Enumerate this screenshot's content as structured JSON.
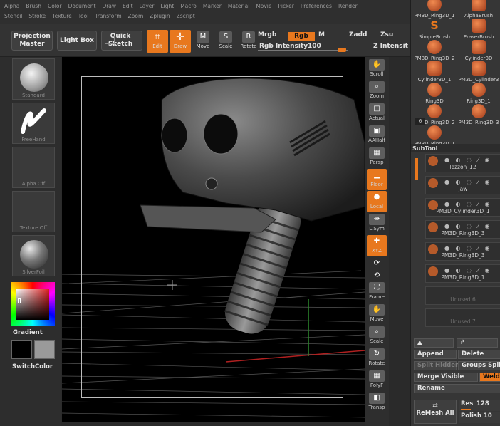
{
  "menus": {
    "row1": [
      "Alpha",
      "Brush",
      "Color",
      "Document",
      "Draw",
      "Edit",
      "Layer",
      "Light",
      "Macro",
      "Marker",
      "Material",
      "Movie",
      "Picker",
      "Preferences",
      "Render"
    ],
    "row2": [
      "Stencil",
      "Stroke",
      "Texture",
      "Tool",
      "Transform",
      "Zoom",
      "Zplugin",
      "Zscript"
    ]
  },
  "toolbar": {
    "projection_master": "Projection Master",
    "light_box": "Light Box",
    "quick_sketch": "Quick Sketch",
    "tools": [
      {
        "label": "Edit",
        "icon": "edit-icon",
        "active": true
      },
      {
        "label": "Draw",
        "icon": "draw-icon",
        "active": true
      },
      {
        "label": "Move",
        "icon": "move-icon",
        "active": false
      },
      {
        "label": "Scale",
        "icon": "scale-icon",
        "active": false
      },
      {
        "label": "Rotate",
        "icon": "rotate-icon",
        "active": false
      }
    ],
    "mrgb": "Mrgb",
    "rgb": "Rgb",
    "m": "M",
    "zadd": "Zadd",
    "zsub": "Zsu",
    "rgb_intensity_label": "Rgb Intensity",
    "rgb_intensity_value": "100",
    "z_intensity_label": "Z Intensit",
    "accent": "#e8781e"
  },
  "left_shelf": {
    "brush_label": "Standard",
    "stroke_label": "FreeHand",
    "alpha_label": "Alpha Off",
    "texture_label": "Texture Off",
    "material_label": "SilverFoil",
    "gradient_label": "Gradient",
    "switch_color_label": "SwitchColor",
    "main_color": "#000000",
    "secondary_color": "#9a9a9a"
  },
  "viewport_tools": [
    {
      "label": "Scroll",
      "icon": "scroll-icon",
      "active": false
    },
    {
      "label": "Zoom",
      "icon": "zoom-icon",
      "active": false
    },
    {
      "label": "Actual",
      "icon": "actual-icon",
      "active": false
    },
    {
      "label": "AAHalf",
      "icon": "aahalf-icon",
      "active": false
    },
    {
      "label": "Persp",
      "icon": "persp-icon",
      "active": false
    },
    {
      "label": "Floor",
      "icon": "floor-icon",
      "active": true
    },
    {
      "label": "Local",
      "icon": "local-icon",
      "active": true
    },
    {
      "label": "L.Sym",
      "icon": "lsym-icon",
      "active": false
    },
    {
      "label": "XYZ",
      "icon": "xyz-icon",
      "active": true
    },
    {
      "label": "",
      "icon": "rotate-y-icon",
      "active": false
    },
    {
      "label": "",
      "icon": "rotate-z-icon",
      "active": false
    },
    {
      "label": "Frame",
      "icon": "frame-icon",
      "active": false
    },
    {
      "label": "Move",
      "icon": "move-icon",
      "active": false
    },
    {
      "label": "Scale",
      "icon": "scale-icon",
      "active": false
    },
    {
      "label": "Rotate",
      "icon": "rotate-icon",
      "active": false
    },
    {
      "label": "PolyF",
      "icon": "polyf-icon",
      "active": false
    },
    {
      "label": "Transp",
      "icon": "transp-icon",
      "active": false
    }
  ],
  "right_panel": {
    "brushes": [
      "PM3D_Ring3D_1",
      "AlphaBrush",
      "SimpleBrush",
      "EraserBrush",
      "PM3D_Ring3D_2",
      "Cylinder3D",
      "Cylinder3D_1",
      "PM3D_Cylinder3",
      "Ring3D",
      "Ring3D_1",
      "PM3D_Ring3D_2",
      "PM3D_Ring3D_3",
      "PM3D_Ring3D_1"
    ],
    "brush_count_badge": "6",
    "subtool_title": "SubTool",
    "subtools": [
      {
        "name": "lezzon_12",
        "ghost": false
      },
      {
        "name": "jaw",
        "ghost": false
      },
      {
        "name": "PM3D_Cylinder3D_1",
        "ghost": false
      },
      {
        "name": "PM3D_Ring3D_3",
        "ghost": false
      },
      {
        "name": "PM3D_Ring3D_3",
        "ghost": false
      },
      {
        "name": "PM3D_Ring3D_1",
        "ghost": false
      },
      {
        "name": "Unused 6",
        "ghost": true
      },
      {
        "name": "Unused 7",
        "ghost": true
      }
    ],
    "append": "Append",
    "delete": "Delete",
    "split_hidden": "Split Hidden",
    "groups_split": "Groups Split",
    "merge_visible": "Merge Visible",
    "weld": "Weld",
    "rename": "Rename",
    "res_label": "Res",
    "res_value": "128",
    "remesh_all": "ReMesh All",
    "polish_label": "Polish",
    "polish_value": "10"
  }
}
